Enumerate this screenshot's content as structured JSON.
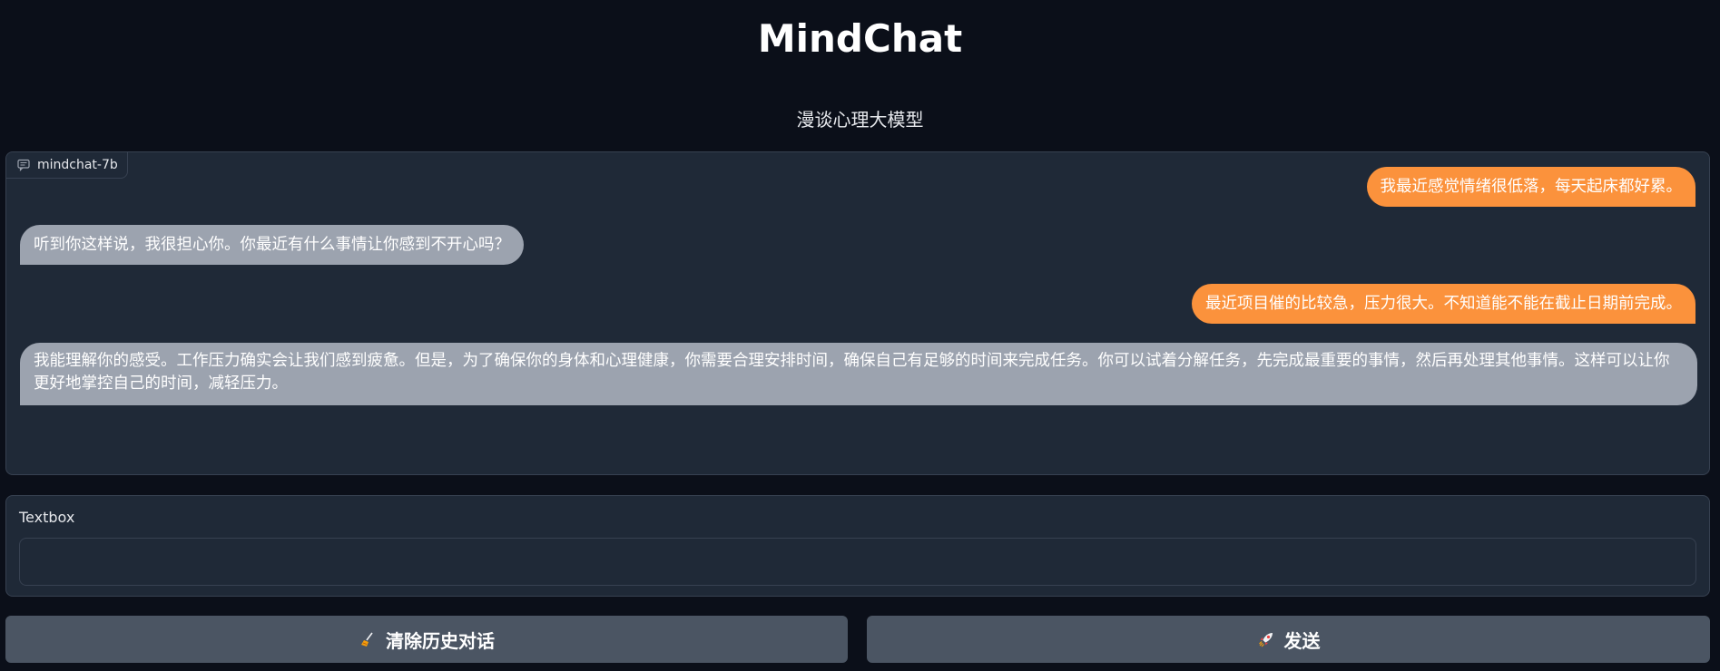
{
  "header": {
    "title": "MindChat",
    "subtitle": "漫谈心理大模型"
  },
  "chat": {
    "label": "mindchat-7b",
    "label_icon": "chat-bubble-icon",
    "messages": [
      {
        "role": "user",
        "text": "我最近感觉情绪很低落，每天起床都好累。"
      },
      {
        "role": "bot",
        "text": "听到你这样说，我很担心你。你最近有什么事情让你感到不开心吗？"
      },
      {
        "role": "user",
        "text": "最近项目催的比较急，压力很大。不知道能不能在截止日期前完成。"
      },
      {
        "role": "bot",
        "text": "我能理解你的感受。工作压力确实会让我们感到疲惫。但是，为了确保你的身体和心理健康，你需要合理安排时间，确保自己有足够的时间来完成任务。你可以试着分解任务，先完成最重要的事情，然后再处理其他事情。这样可以让你更好地掌控自己的时间，减轻压力。"
      }
    ],
    "colors": {
      "user": "#fb923c",
      "bot": "#9ca3af"
    }
  },
  "input": {
    "label": "Textbox",
    "value": "",
    "placeholder": ""
  },
  "buttons": {
    "clear_label": "清除历史对话",
    "clear_icon": "broom-icon",
    "send_label": "发送",
    "send_icon": "rocket-icon"
  }
}
